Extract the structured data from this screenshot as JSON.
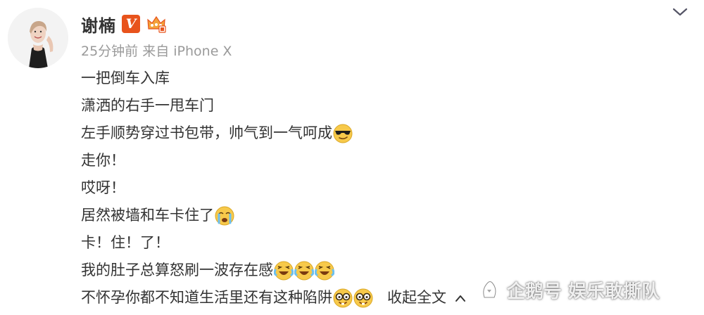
{
  "post": {
    "username": "谢楠",
    "verified_badge": "V",
    "meta": "25分钟前  来自 iPhone X",
    "lines": [
      {
        "text": "一把倒车入库",
        "emojis": []
      },
      {
        "text": "潇洒的右手一甩车门",
        "emojis": []
      },
      {
        "text": "左手顺势穿过书包带，帅气到一气呵成",
        "emojis": [
          "cool-face-emoji"
        ]
      },
      {
        "text": "走你！",
        "emojis": []
      },
      {
        "text": "哎呀！",
        "emojis": []
      },
      {
        "text": "居然被墙和车卡住了",
        "emojis": [
          "crying-face-emoji"
        ]
      },
      {
        "text": "卡！住！了！",
        "emojis": []
      },
      {
        "text": "我的肚子总算怒刷一波存在感",
        "emojis": [
          "laughing-tears-emoji",
          "laughing-tears-emoji",
          "laughing-tears-emoji"
        ]
      },
      {
        "text": "不怀孕你都不知道生活里还有这种陷阱",
        "emojis": [
          "nerd-face-emoji",
          "nerd-face-emoji"
        ]
      }
    ],
    "collapse_label": "收起全文"
  },
  "watermark": {
    "text": "企鹅号 娱乐敢撕队"
  },
  "colors": {
    "text": "#333333",
    "meta": "#9a9a9a",
    "vip_orange": "#e8531c",
    "emoji_yellow": "#f7c94a"
  }
}
